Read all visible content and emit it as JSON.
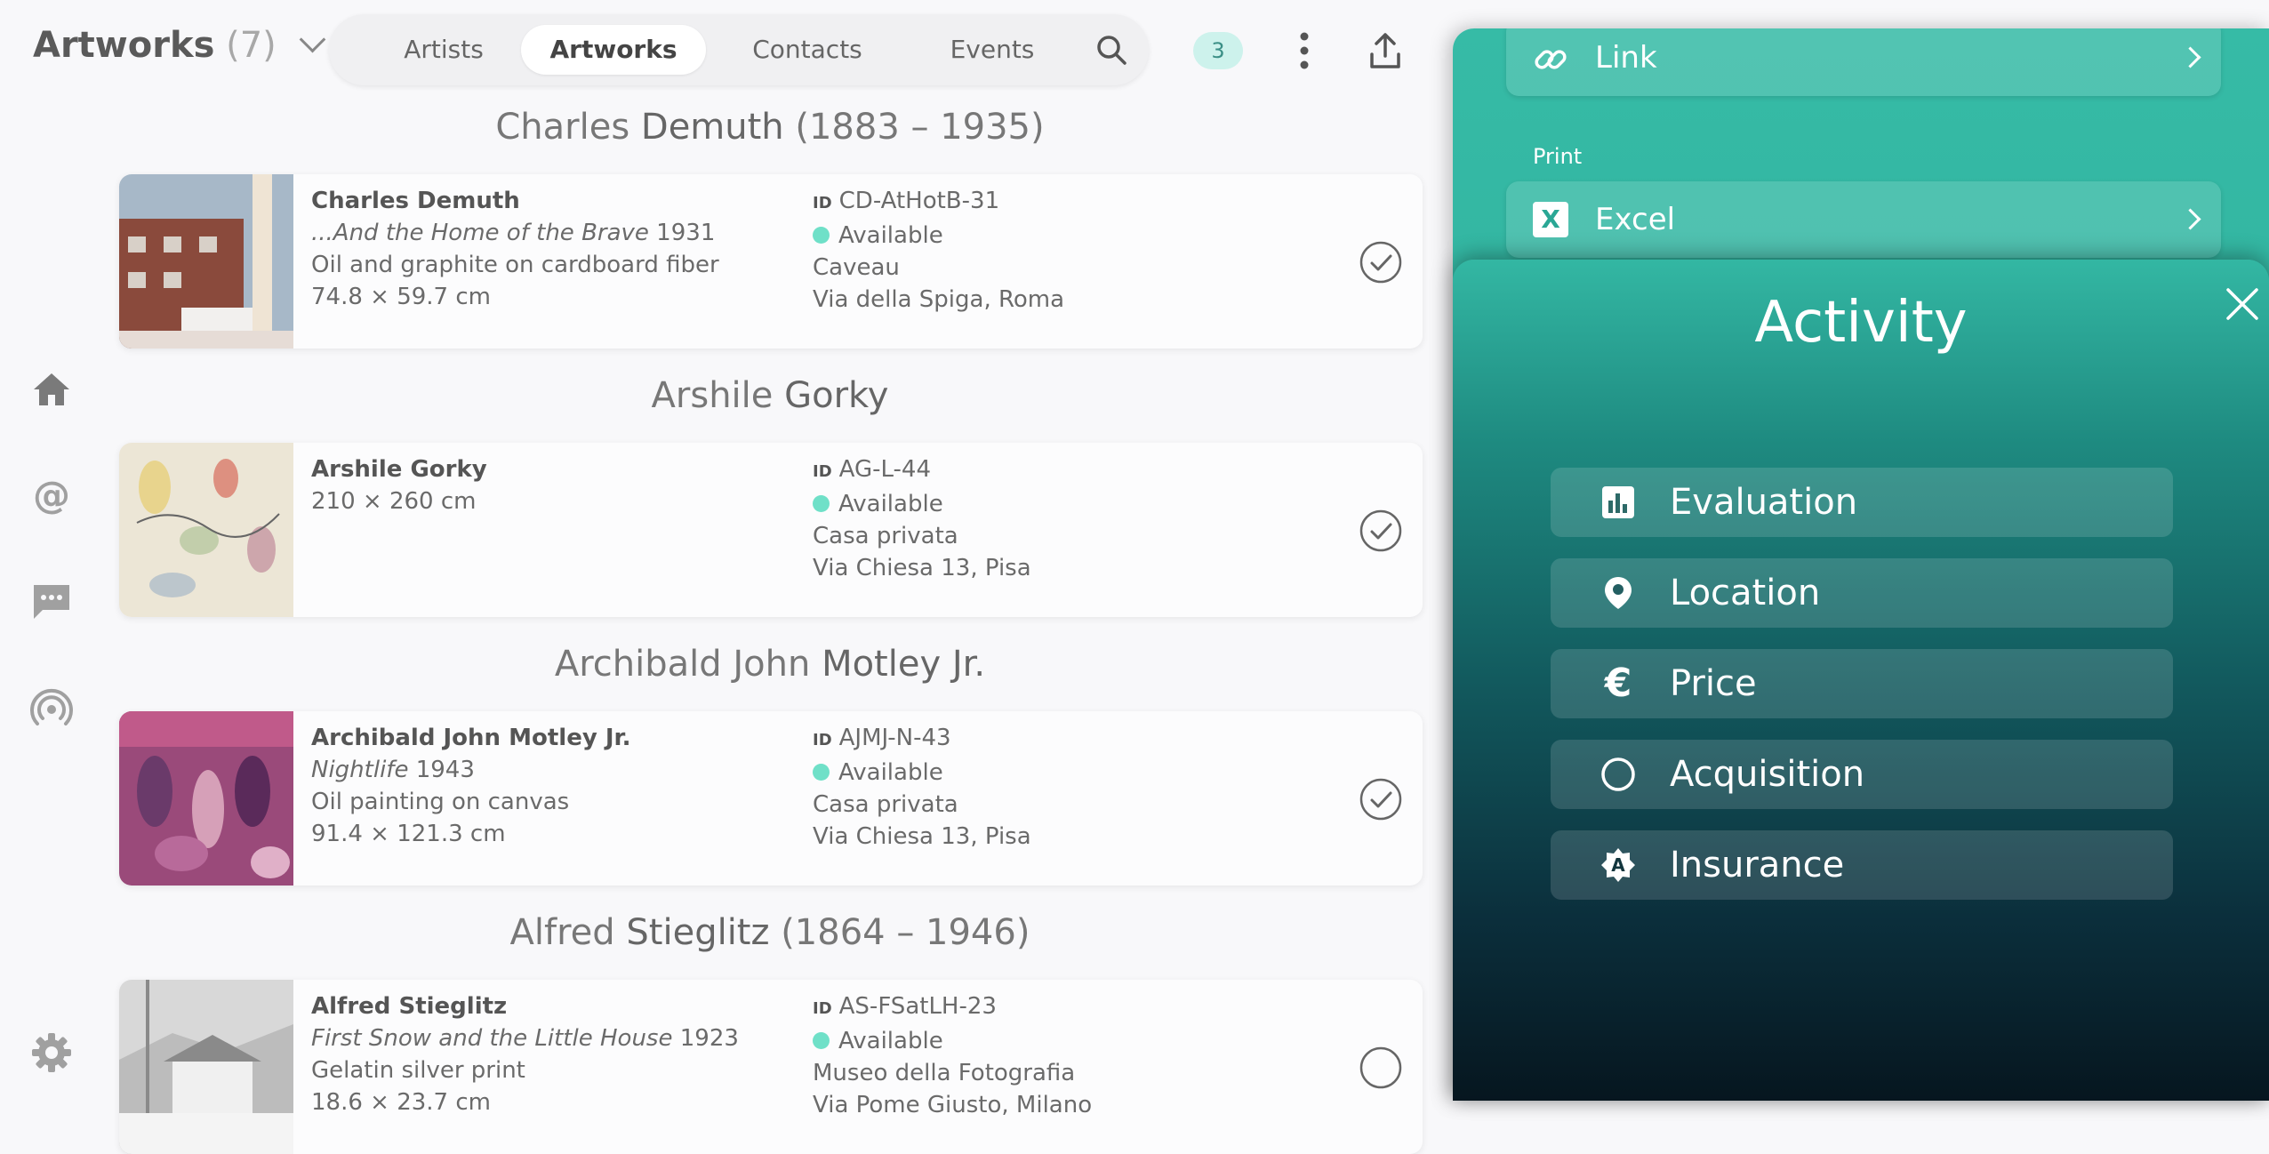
{
  "header": {
    "title": "Artworks",
    "count": "(7)",
    "tabs": [
      "Artists",
      "Artworks",
      "Contacts",
      "Events"
    ],
    "active_tab": "Artworks",
    "badge": "3"
  },
  "artists": [
    {
      "heading_first": "Charles ",
      "heading_last": "Demuth",
      "heading_years": " (1883 – 1935)",
      "name": "Charles Demuth",
      "title": "...And the Home of the Brave",
      "year": " 1931",
      "medium": "Oil and graphite on cardboard fiber",
      "size": "74.8 × 59.7 cm",
      "id_label": "ID",
      "id": "CD-AtHotB-31",
      "status": "Available",
      "place": "Caveau",
      "address": "Via della Spiga, Roma",
      "checked": true
    },
    {
      "heading_first": "Arshile ",
      "heading_last": "Gorky",
      "heading_years": "",
      "name": "Arshile Gorky",
      "size": "210 × 260 cm",
      "id_label": "ID",
      "id": "AG-L-44",
      "status": "Available",
      "place": "Casa privata",
      "address": "Via Chiesa 13, Pisa",
      "checked": true
    },
    {
      "heading_first": "Archibald John ",
      "heading_last": "Motley Jr.",
      "heading_years": "",
      "name": "Archibald John Motley Jr.",
      "title": "Nightlife",
      "year": " 1943",
      "medium": "Oil painting on canvas",
      "size": "91.4 × 121.3 cm",
      "id_label": "ID",
      "id": "AJMJ-N-43",
      "status": "Available",
      "place": "Casa privata",
      "address": "Via Chiesa 13, Pisa",
      "checked": true
    },
    {
      "heading_first": "Alfred ",
      "heading_last": "Stieglitz",
      "heading_years": " (1864 – 1946)",
      "name": "Alfred Stieglitz",
      "title": "First Snow and the Little House",
      "year": " 1923",
      "medium": "Gelatin silver print",
      "size": "18.6 × 23.7 cm",
      "id_label": "ID",
      "id": "AS-FSatLH-23",
      "status": "Available",
      "place": "Museo della Fotografia",
      "address": "Via Pome Giusto, Milano",
      "checked": false
    }
  ],
  "share_sheet": {
    "link_label": "Link",
    "print_section": "Print",
    "excel_label": "Excel",
    "excel_icon_letter": "X"
  },
  "activity": {
    "title": "Activity",
    "items": [
      {
        "label": "Evaluation",
        "icon": "bar-chart-icon"
      },
      {
        "label": "Location",
        "icon": "map-pin-icon"
      },
      {
        "label": "Price",
        "icon": "euro-icon"
      },
      {
        "label": "Acquisition",
        "icon": "circle-icon"
      },
      {
        "label": "Insurance",
        "icon": "insurance-badge-icon"
      }
    ],
    "insurance_icon_letter": "A",
    "price_symbol": "€"
  },
  "colors": {
    "accent": "#36bba6",
    "status_available": "#6fe0c8",
    "badge_bg": "#cdf2ec"
  }
}
